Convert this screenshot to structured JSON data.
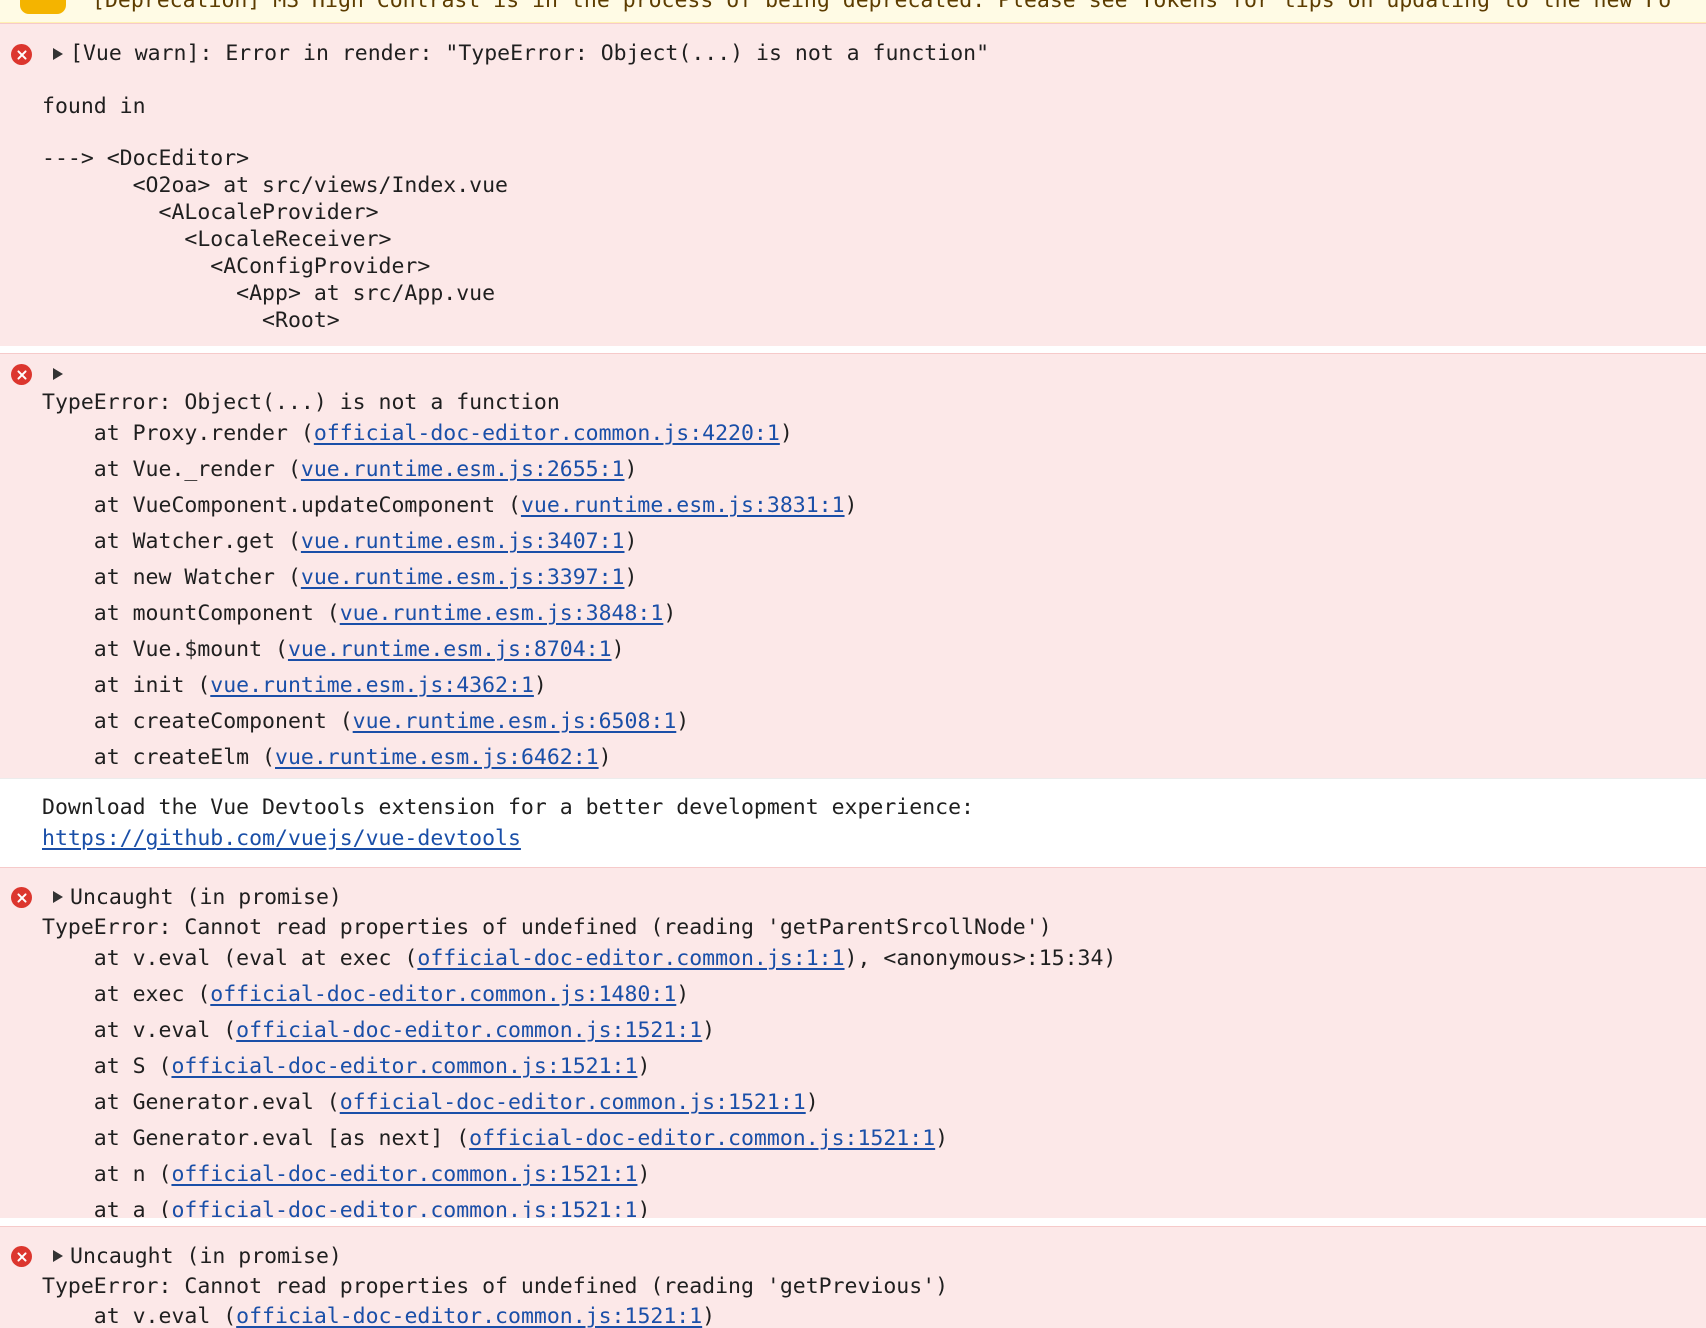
{
  "top_warning": {
    "text": "[Deprecation] MS High Contrast is in the process of being deprecated. Please see Tokens for tips on updating to the new Fo"
  },
  "messages": [
    {
      "kind": "error",
      "summary": "[Vue warn]: Error in render: \"TypeError: Object(...) is not a function\"",
      "found_in_label": "found in",
      "tree": [
        "---> <DocEditor>",
        "       <O2oa> at src/views/Index.vue",
        "         <ALocaleProvider>",
        "           <LocaleReceiver>",
        "             <AConfigProvider>",
        "               <App> at src/App.vue",
        "                 <Root>"
      ]
    },
    {
      "kind": "error",
      "header": "TypeError: Object(...) is not a function",
      "stack": [
        {
          "prefix": "    at Proxy.render (",
          "link": "official-doc-editor.common.js:4220:1",
          "suffix": ")"
        },
        {
          "prefix": "    at Vue._render (",
          "link": "vue.runtime.esm.js:2655:1",
          "suffix": ")"
        },
        {
          "prefix": "    at VueComponent.updateComponent (",
          "link": "vue.runtime.esm.js:3831:1",
          "suffix": ")"
        },
        {
          "prefix": "    at Watcher.get (",
          "link": "vue.runtime.esm.js:3407:1",
          "suffix": ")"
        },
        {
          "prefix": "    at new Watcher (",
          "link": "vue.runtime.esm.js:3397:1",
          "suffix": ")"
        },
        {
          "prefix": "    at mountComponent (",
          "link": "vue.runtime.esm.js:3848:1",
          "suffix": ")"
        },
        {
          "prefix": "    at Vue.$mount (",
          "link": "vue.runtime.esm.js:8704:1",
          "suffix": ")"
        },
        {
          "prefix": "    at init (",
          "link": "vue.runtime.esm.js:4362:1",
          "suffix": ")"
        },
        {
          "prefix": "    at createComponent (",
          "link": "vue.runtime.esm.js:6508:1",
          "suffix": ")"
        },
        {
          "prefix": "    at createElm (",
          "link": "vue.runtime.esm.js:6462:1",
          "suffix": ")"
        }
      ]
    },
    {
      "kind": "info",
      "text": "Download the Vue Devtools extension for a better development experience:",
      "link": "https://github.com/vuejs/vue-devtools"
    },
    {
      "kind": "error",
      "summary": "Uncaught (in promise)",
      "header": "TypeError: Cannot read properties of undefined (reading 'getParentSrcollNode')",
      "stack": [
        {
          "prefix": "    at v.eval (eval at exec (",
          "link": "official-doc-editor.common.js:1:1",
          "suffix": "), <anonymous>:15:34)"
        },
        {
          "prefix": "    at exec (",
          "link": "official-doc-editor.common.js:1480:1",
          "suffix": ")"
        },
        {
          "prefix": "    at v.eval (",
          "link": "official-doc-editor.common.js:1521:1",
          "suffix": ")"
        },
        {
          "prefix": "    at S (",
          "link": "official-doc-editor.common.js:1521:1",
          "suffix": ")"
        },
        {
          "prefix": "    at Generator.eval (",
          "link": "official-doc-editor.common.js:1521:1",
          "suffix": ")"
        },
        {
          "prefix": "    at Generator.eval [as next] (",
          "link": "official-doc-editor.common.js:1521:1",
          "suffix": ")"
        },
        {
          "prefix": "    at n (",
          "link": "official-doc-editor.common.js:1521:1",
          "suffix": ")"
        },
        {
          "prefix": "    at a (",
          "link": "official-doc-editor.common.js:1521:1",
          "suffix": ")"
        }
      ]
    },
    {
      "kind": "error",
      "summary": "Uncaught (in promise)",
      "header": "TypeError: Cannot read properties of undefined (reading 'getPrevious')",
      "stack": [
        {
          "prefix": "    at v.eval (",
          "link": "official-doc-editor.common.js:1521:1",
          "suffix": ")"
        }
      ]
    }
  ],
  "colors": {
    "error_bg": "#fce8e8",
    "error_icon": "#dc362e",
    "link": "#1a4fa8",
    "warning_badge": "#f4b400"
  }
}
